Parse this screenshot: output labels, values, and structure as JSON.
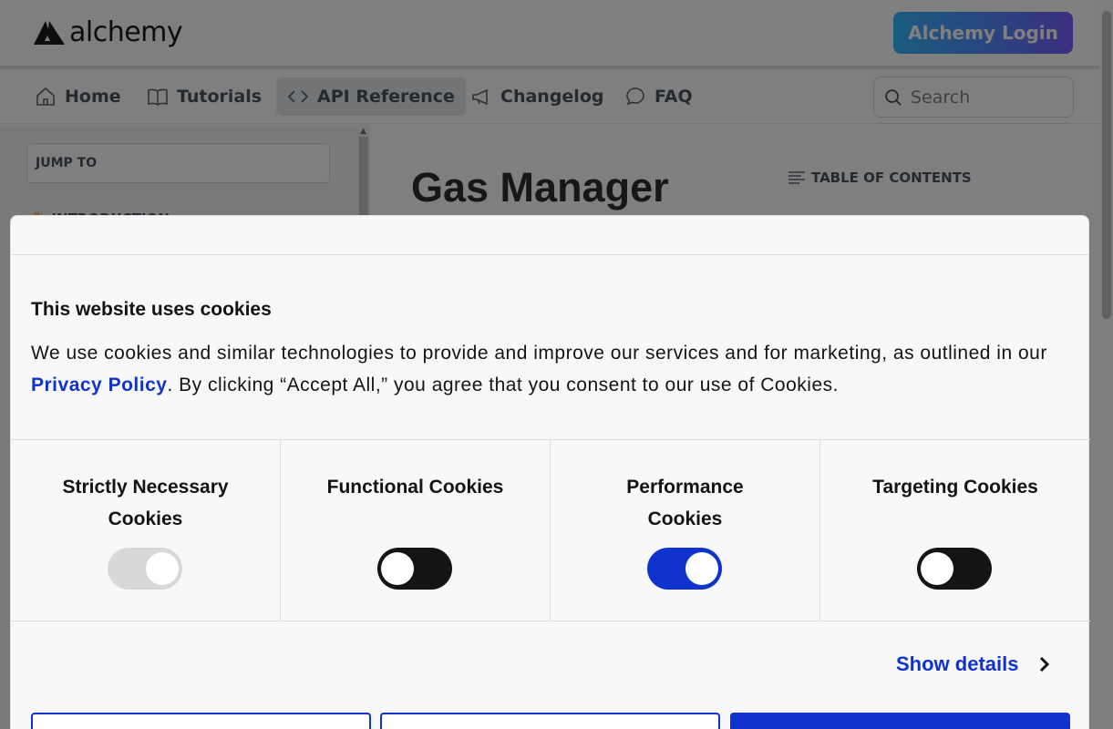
{
  "header": {
    "logo_text": "alchemy",
    "login_label": "Alchemy Login"
  },
  "nav": {
    "items": [
      {
        "label": "Home",
        "icon": "home-icon"
      },
      {
        "label": "Tutorials",
        "icon": "book-icon"
      },
      {
        "label": "API Reference",
        "icon": "code-icon",
        "active": true
      },
      {
        "label": "Changelog",
        "icon": "megaphone-icon"
      },
      {
        "label": "FAQ",
        "icon": "chat-icon"
      }
    ],
    "search_placeholder": "Search"
  },
  "sidebar": {
    "jump_to": "JUMP TO",
    "section": "INTRODUCTION"
  },
  "main": {
    "title": "Gas Manager",
    "toc_label": "TABLE OF CONTENTS"
  },
  "cookie_banner": {
    "title": "This website uses cookies",
    "text_before": "We use cookies and similar technologies to provide and improve our services and for marketing, as outlined in our ",
    "link_text": "Privacy Policy",
    "text_after": ". By clicking “Accept All,” you agree that you consent to our use of Cookies.",
    "categories": [
      {
        "label": "Strictly Necessary Cookies",
        "state": "disabled"
      },
      {
        "label": "Functional Cookies",
        "state": "off"
      },
      {
        "label": "Performance Cookies",
        "state": "on"
      },
      {
        "label": "Targeting Cookies",
        "state": "off"
      }
    ],
    "show_details": "Show details",
    "colors": {
      "accent": "#1032cf",
      "toggle_off": "#141414",
      "toggle_disabled": "#d8d8d8"
    }
  }
}
